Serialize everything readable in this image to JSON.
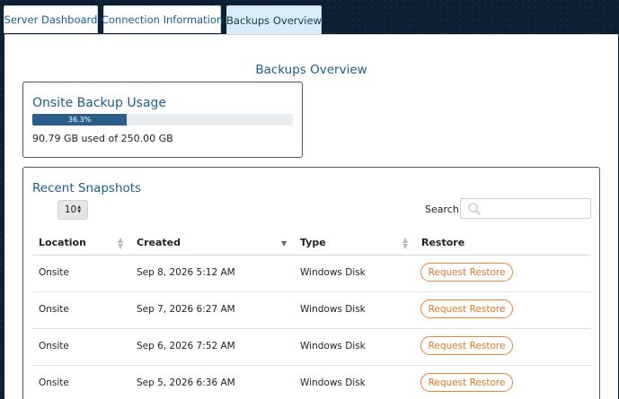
{
  "tabs": [
    {
      "label": "Server Dashboard",
      "active": false
    },
    {
      "label": "Connection Information",
      "active": false
    },
    {
      "label": "Backups Overview",
      "active": true
    }
  ],
  "page_title": "Backups Overview",
  "usage": {
    "title": "Onsite Backup Usage",
    "percent": 36.3,
    "percent_label": "36.3%",
    "summary": "90.79 GB used of 250.00 GB"
  },
  "snapshots": {
    "title": "Recent Snapshots",
    "page_length": "10",
    "search_label": "Search:",
    "search_value": "",
    "columns": [
      "Location",
      "Created",
      "Type",
      "Restore"
    ],
    "sorted_column": "Created",
    "sort_direction": "desc",
    "rows": [
      {
        "location": "Onsite",
        "created": "Sep 8, 2026 5:12 AM",
        "type": "Windows Disk",
        "restore_label": "Request Restore"
      },
      {
        "location": "Onsite",
        "created": "Sep 7, 2026 6:27 AM",
        "type": "Windows Disk",
        "restore_label": "Request Restore"
      },
      {
        "location": "Onsite",
        "created": "Sep 6, 2026 7:52 AM",
        "type": "Windows Disk",
        "restore_label": "Request Restore"
      },
      {
        "location": "Onsite",
        "created": "Sep 5, 2026 6:36 AM",
        "type": "Windows Disk",
        "restore_label": "Request Restore"
      }
    ]
  },
  "colors": {
    "accent": "#1a5e8a",
    "bar_fill": "#2b5d8c",
    "restore": "#e0762a",
    "background": "#0c1f33"
  },
  "icons": {
    "search": "search-icon",
    "sort": "sort-arrows-icon",
    "select": "select-arrows-icon"
  }
}
